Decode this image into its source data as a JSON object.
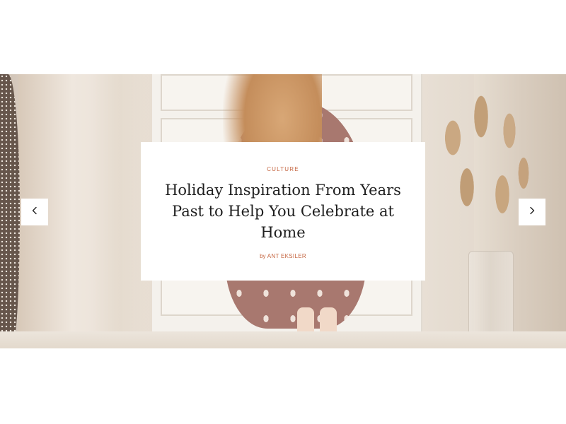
{
  "hero": {
    "category": "CULTURE",
    "title": "Holiday Inspiration From Years Past to Help You Celebrate at Home",
    "byline_prefix": "by",
    "author": "ANT EKSILER"
  },
  "controls": {
    "prev_icon": "chevron-left-icon",
    "next_icon": "chevron-right-icon"
  },
  "colors": {
    "accent": "#c4643f",
    "title": "#1e1e1e",
    "card_bg": "#ffffff"
  }
}
